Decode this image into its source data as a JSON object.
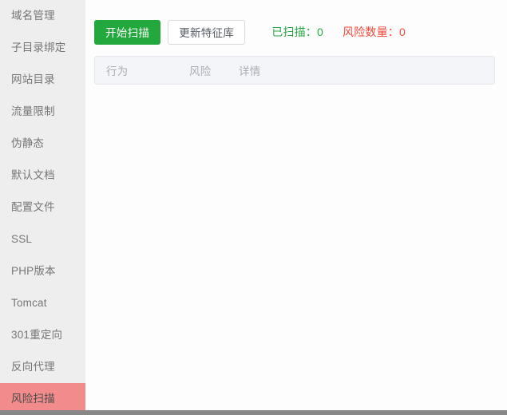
{
  "sidebar": {
    "items": [
      {
        "label": "域名管理",
        "active": false
      },
      {
        "label": "子目录绑定",
        "active": false
      },
      {
        "label": "网站目录",
        "active": false
      },
      {
        "label": "流量限制",
        "active": false
      },
      {
        "label": "伪静态",
        "active": false
      },
      {
        "label": "默认文档",
        "active": false
      },
      {
        "label": "配置文件",
        "active": false
      },
      {
        "label": "SSL",
        "active": false
      },
      {
        "label": "PHP版本",
        "active": false
      },
      {
        "label": "Tomcat",
        "active": false
      },
      {
        "label": "301重定向",
        "active": false
      },
      {
        "label": "反向代理",
        "active": false
      },
      {
        "label": "风险扫描",
        "active": true
      }
    ]
  },
  "toolbar": {
    "start_scan_label": "开始扫描",
    "update_signature_label": "更新特征库",
    "scanned_label": "已扫描：0",
    "risk_count_label": "风险数量：0"
  },
  "table": {
    "columns": [
      "行为",
      "风险",
      "详情"
    ],
    "rows": []
  },
  "colors": {
    "primary_green": "#22a83c",
    "active_pink": "#f28b8b",
    "scanned_green": "#29a745",
    "risk_red": "#f5483a",
    "sidebar_bg": "#eeeeee",
    "table_head_bg": "#f4f5f8"
  }
}
